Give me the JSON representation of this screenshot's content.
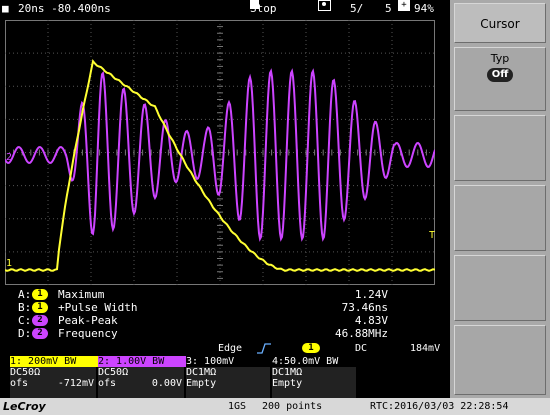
{
  "status_bar": {
    "timebase": "20ns -80.400ns",
    "run_state": "Stop",
    "sweep_count": "5/",
    "sweep_total": "5",
    "battery_percent": "94%"
  },
  "waveform": {
    "channel_labels": [
      "2",
      "1"
    ],
    "trigger_marker": "T",
    "trace_colors": {
      "ch1": "#ffff33",
      "ch2": "#cc44ff"
    }
  },
  "measurements": [
    {
      "letter": "A:",
      "channel": "1",
      "channel_color": "#ffff00",
      "name": "Maximum",
      "value": "1.24V"
    },
    {
      "letter": "B:",
      "channel": "1",
      "channel_color": "#ffff00",
      "name": "+Pulse Width",
      "value": "73.46ns"
    },
    {
      "letter": "C:",
      "channel": "2",
      "channel_color": "#cc44ff",
      "name": "Peak-Peak",
      "value": "4.83V"
    },
    {
      "letter": "D:",
      "channel": "2",
      "channel_color": "#cc44ff",
      "name": "Frequency",
      "value": "46.88MHz"
    }
  ],
  "trigger": {
    "mode": "Edge",
    "source": "1",
    "coupling": "DC",
    "level": "184mV"
  },
  "channels": [
    {
      "header": "1: 200mV  BW",
      "line1": "DC50Ω",
      "line2_label": "ofs",
      "line2_value": "-712mV",
      "color": "#ffff00"
    },
    {
      "header": "2: 1.00V  BW",
      "line1": "DC50Ω",
      "line2_label": "ofs",
      "line2_value": "0.00V",
      "color": "#cc44ff"
    },
    {
      "header": "3: 100mV",
      "line1": "DC1MΩ",
      "line2_label": "Empty",
      "line2_value": "",
      "color": "#ffffff"
    },
    {
      "header": "4:50.0mV  BW",
      "line1": "DC1MΩ",
      "line2_label": "Empty",
      "line2_value": "",
      "color": "#ffffff"
    }
  ],
  "bottom_bar": {
    "brand": "LeCroy",
    "sample_rate": "1GS",
    "points": "200 points",
    "rtc": "RTC:2016/03/03 22:28:54"
  },
  "side_menu": {
    "title": "Cursor",
    "type_label": "Typ",
    "type_value": "Off"
  }
}
